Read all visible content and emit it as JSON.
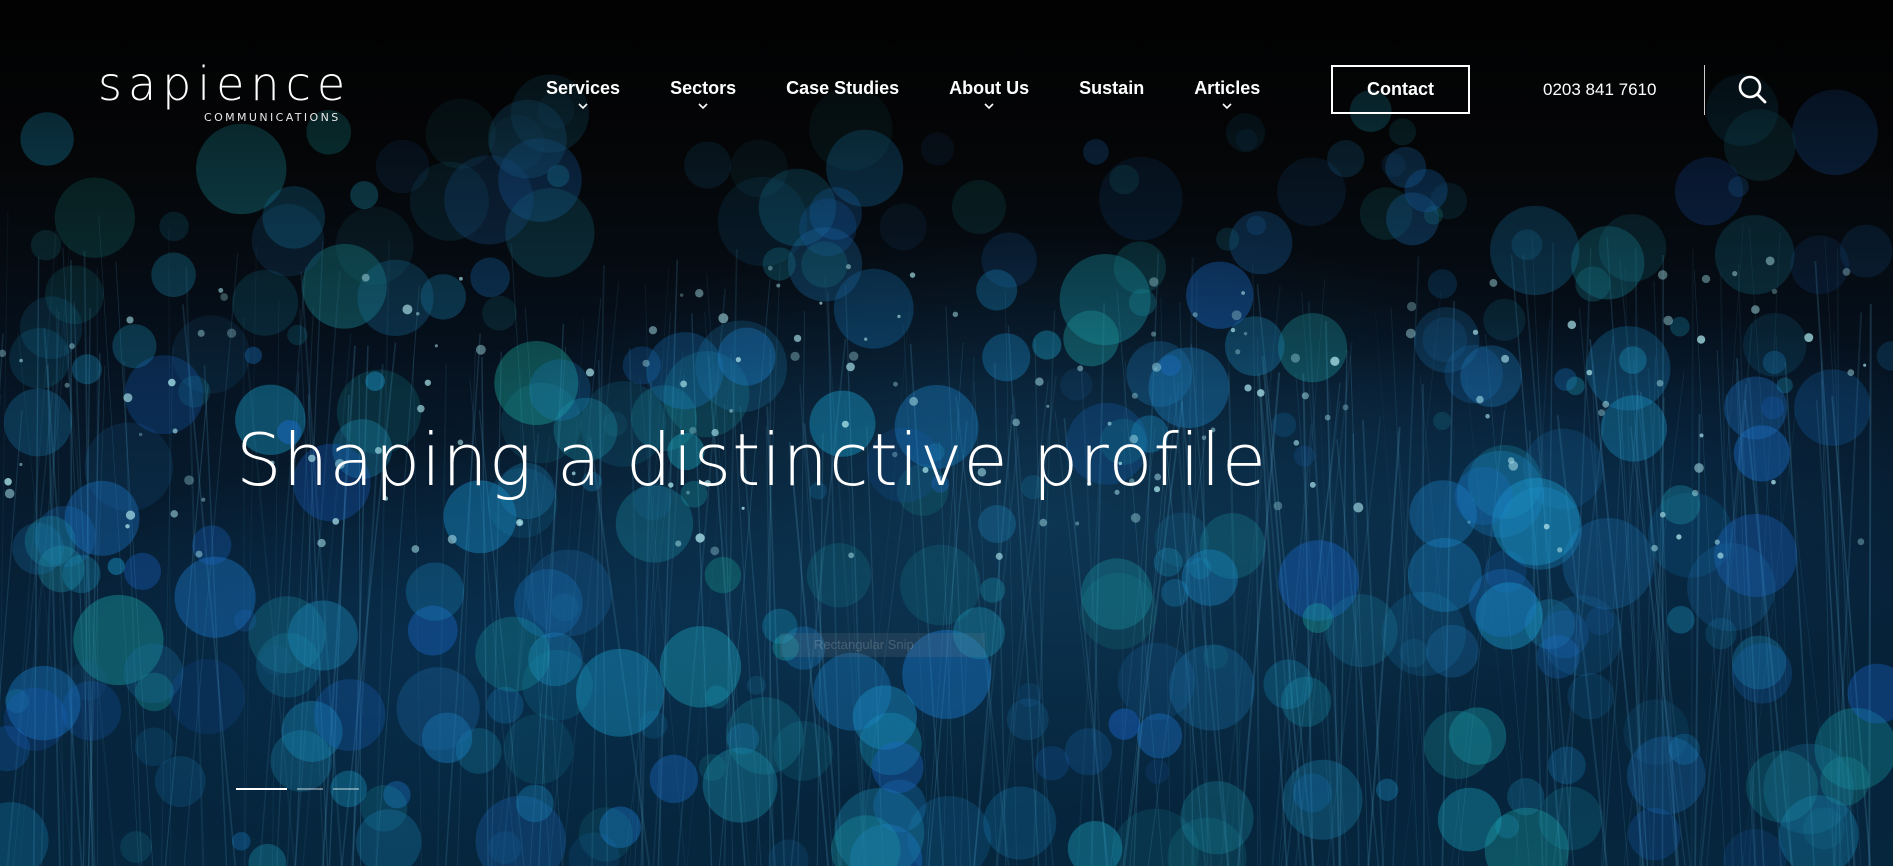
{
  "brand": {
    "logo_word": "sapience",
    "logo_sub": "COMMUNICATIONS"
  },
  "nav": {
    "items": [
      {
        "label": "Services",
        "has_dropdown": true
      },
      {
        "label": "Sectors",
        "has_dropdown": true
      },
      {
        "label": "Case Studies",
        "has_dropdown": false
      },
      {
        "label": "About Us",
        "has_dropdown": true
      },
      {
        "label": "Sustain",
        "has_dropdown": false
      },
      {
        "label": "Articles",
        "has_dropdown": true
      }
    ],
    "contact_label": "Contact",
    "phone": "0203 841 7610",
    "search_icon": "search-icon"
  },
  "hero": {
    "headline": "Shaping a distinctive profile",
    "ghost_label": "Rectangular Snip",
    "slides": {
      "count": 3,
      "active_index": 0
    }
  },
  "colors": {
    "background": "#050608",
    "accent_blue": "#0b5f8a",
    "text": "#ffffff"
  }
}
